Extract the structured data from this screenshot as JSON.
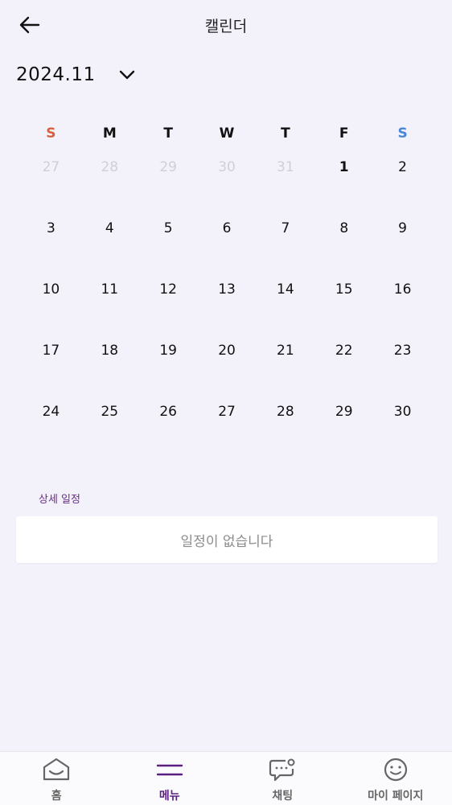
{
  "header": {
    "title": "캘린더"
  },
  "month": {
    "label": "2024.11"
  },
  "colors": {
    "sunday": "#d9603b",
    "saturday": "#4a86d6",
    "accent": "#5b1f82"
  },
  "weekdays": [
    "S",
    "M",
    "T",
    "W",
    "T",
    "F",
    "S"
  ],
  "weeks": [
    [
      {
        "d": "27",
        "m": true
      },
      {
        "d": "28",
        "m": true
      },
      {
        "d": "29",
        "m": true
      },
      {
        "d": "30",
        "m": true
      },
      {
        "d": "31",
        "m": true
      },
      {
        "d": "1",
        "b": true
      },
      {
        "d": "2"
      }
    ],
    [
      {
        "d": "3"
      },
      {
        "d": "4"
      },
      {
        "d": "5"
      },
      {
        "d": "6"
      },
      {
        "d": "7"
      },
      {
        "d": "8"
      },
      {
        "d": "9"
      }
    ],
    [
      {
        "d": "10"
      },
      {
        "d": "11"
      },
      {
        "d": "12"
      },
      {
        "d": "13"
      },
      {
        "d": "14"
      },
      {
        "d": "15"
      },
      {
        "d": "16"
      }
    ],
    [
      {
        "d": "17"
      },
      {
        "d": "18"
      },
      {
        "d": "19"
      },
      {
        "d": "20"
      },
      {
        "d": "21"
      },
      {
        "d": "22"
      },
      {
        "d": "23"
      }
    ],
    [
      {
        "d": "24"
      },
      {
        "d": "25"
      },
      {
        "d": "26"
      },
      {
        "d": "27"
      },
      {
        "d": "28"
      },
      {
        "d": "29"
      },
      {
        "d": "30"
      }
    ]
  ],
  "detail": {
    "section_label": "상세 일정",
    "empty_text": "일정이 없습니다"
  },
  "nav": {
    "home": "홈",
    "menu": "메뉴",
    "chat": "채팅",
    "mypage": "마이 페이지"
  }
}
